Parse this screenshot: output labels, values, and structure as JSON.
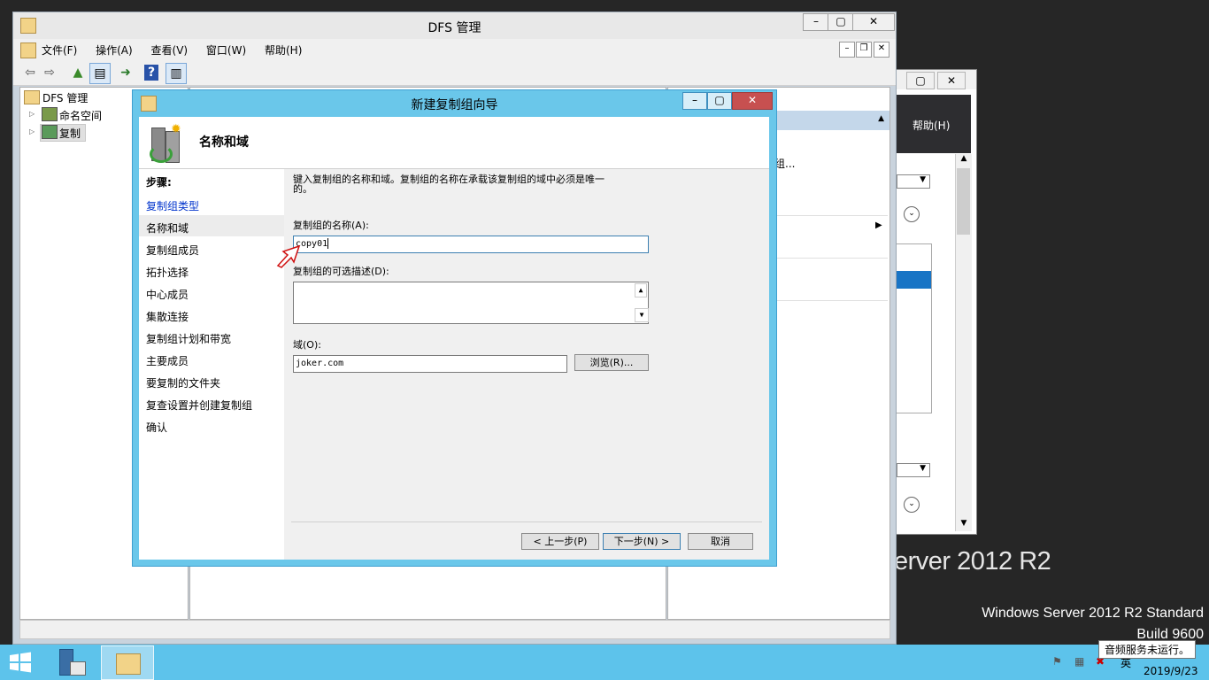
{
  "desktop": {
    "watermark_big": "erver 2012 R2",
    "edition": "Windows Server 2012 R2 Standard",
    "build": "Build 9600"
  },
  "bg_window": {
    "menu_help": "帮助(H)",
    "text_fragment": "组..."
  },
  "main_window": {
    "title": "DFS 管理",
    "menu": [
      "文件(F)",
      "操作(A)",
      "查看(V)",
      "窗口(W)",
      "帮助(H)"
    ],
    "tree": {
      "root": "DFS 管理",
      "items": [
        "命名空间",
        "复制"
      ]
    }
  },
  "wizard": {
    "title": "新建复制组向导",
    "header_title": "名称和域",
    "steps_heading": "步骤:",
    "steps": [
      "复制组类型",
      "名称和域",
      "复制组成员",
      "拓扑选择",
      "中心成员",
      "集散连接",
      "复制组计划和带宽",
      "主要成员",
      "要复制的文件夹",
      "复查设置并创建复制组",
      "确认"
    ],
    "current_step_index": 1,
    "intro_line1": "键入复制组的名称和域。复制组的名称在承载该复制组的域中必须是唯一",
    "intro_line2": "的。",
    "name_label": "复制组的名称(A):",
    "name_value": "copy01",
    "desc_label": "复制组的可选描述(D):",
    "desc_value": "",
    "domain_label": "域(O):",
    "domain_value": "joker.com",
    "browse_button": "浏览(R)...",
    "back_button": "< 上一步(P)",
    "next_button": "下一步(N) >",
    "cancel_button": "取消"
  },
  "tray": {
    "tooltip": "音频服务未运行。",
    "ime": "英",
    "date": "2019/9/23"
  },
  "colors": {
    "taskbar": "#5dc3eb",
    "wizard_frame": "#6ac7ea",
    "link": "#0033cc",
    "selection": "#1874c5"
  }
}
